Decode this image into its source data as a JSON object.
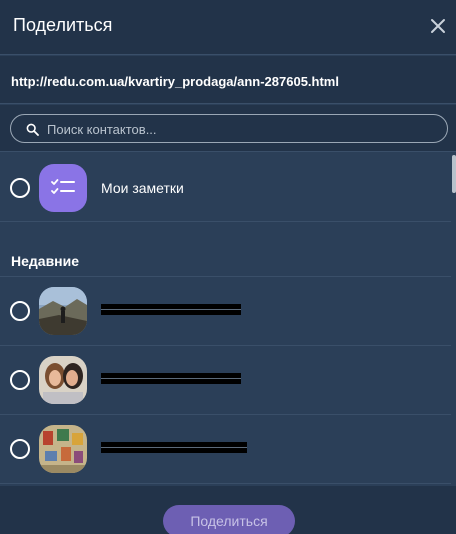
{
  "header": {
    "title": "Поделиться",
    "close_icon": "close-icon"
  },
  "share_url": "http://redu.com.ua/kvartiry_prodaga/ann-287605.html",
  "search": {
    "placeholder": "Поиск контактов...",
    "value": "",
    "icon": "search-icon"
  },
  "notes": {
    "label": "Мои заметки",
    "icon": "notes-checklist-icon",
    "accent": "#8a74e6"
  },
  "recent": {
    "title": "Недавние"
  },
  "footer": {
    "share_label": "Поделиться",
    "button_color": "#6d5fb3"
  },
  "colors": {
    "background": "#2b3f58",
    "panel": "#223349",
    "divider": "#3a4f69"
  }
}
